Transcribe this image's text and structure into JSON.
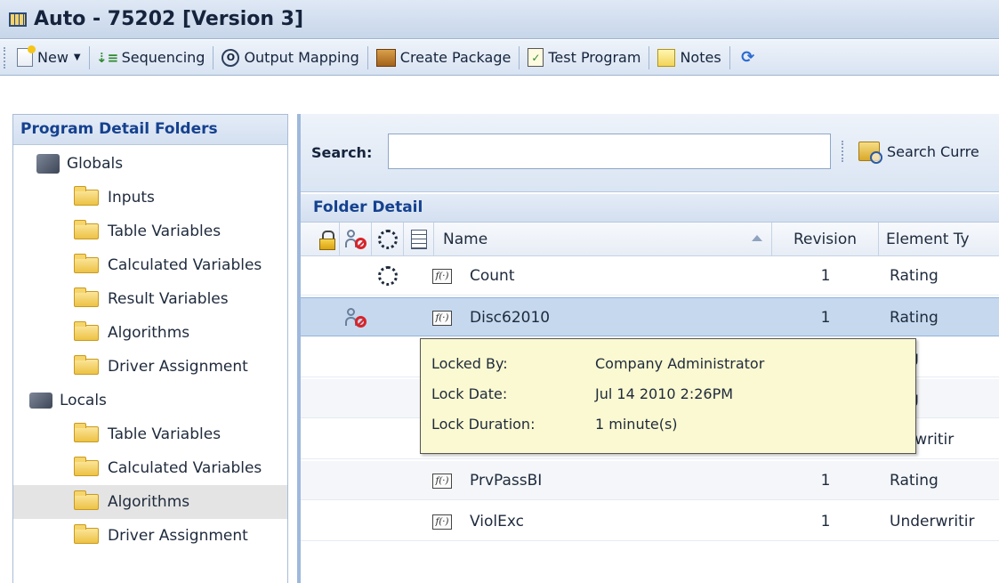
{
  "window": {
    "title": "Auto - 75202 [Version 3]"
  },
  "toolbar": {
    "items": [
      {
        "label": "New",
        "icon": "new-document-icon",
        "has_dropdown": true
      },
      {
        "label": "Sequencing",
        "icon": "sequencing-icon"
      },
      {
        "label": "Output Mapping",
        "icon": "output-mapping-icon"
      },
      {
        "label": "Create Package",
        "icon": "package-icon"
      },
      {
        "label": "Test Program",
        "icon": "test-program-icon"
      },
      {
        "label": "Notes",
        "icon": "notes-icon"
      }
    ]
  },
  "sidebar": {
    "header": "Program Detail Folders",
    "items": [
      {
        "label": "Globals",
        "kind": "group"
      },
      {
        "label": "Inputs",
        "kind": "folder"
      },
      {
        "label": "Table Variables",
        "kind": "folder"
      },
      {
        "label": "Calculated Variables",
        "kind": "folder"
      },
      {
        "label": "Result Variables",
        "kind": "folder"
      },
      {
        "label": "Algorithms",
        "kind": "folder"
      },
      {
        "label": "Driver Assignment",
        "kind": "folder"
      },
      {
        "label": "Locals",
        "kind": "group"
      },
      {
        "label": "Table Variables",
        "kind": "folder"
      },
      {
        "label": "Calculated Variables",
        "kind": "folder"
      },
      {
        "label": "Algorithms",
        "kind": "folder",
        "selected": true
      },
      {
        "label": "Driver Assignment",
        "kind": "folder"
      }
    ]
  },
  "search": {
    "label": "Search:",
    "value": "",
    "button_label": "Search Curre"
  },
  "folder_detail": {
    "header": "Folder Detail",
    "columns": {
      "name": "Name",
      "revision": "Revision",
      "element_type": "Element Ty"
    },
    "rows": [
      {
        "name": "Count",
        "revision": "1",
        "element_type": "Rating",
        "status_icon": "cycle-icon"
      },
      {
        "name": "Disc62010",
        "revision": "1",
        "element_type": "Rating",
        "status_icon": "locked-user-icon",
        "selected": true
      },
      {
        "name": "",
        "revision": "",
        "element_type": "ting"
      },
      {
        "name": "",
        "revision": "",
        "element_type": "ting"
      },
      {
        "name": "",
        "revision": "",
        "element_type": "derwritir"
      },
      {
        "name": "PrvPassBI",
        "revision": "1",
        "element_type": "Rating"
      },
      {
        "name": "ViolExc",
        "revision": "1",
        "element_type": "Underwritir"
      }
    ]
  },
  "tooltip": {
    "locked_by_label": "Locked By:",
    "locked_by_value": "Company Administrator",
    "lock_date_label": "Lock Date:",
    "lock_date_value": "Jul 14 2010 2:26PM",
    "lock_duration_label": "Lock Duration:",
    "lock_duration_value": "1 minute(s)"
  },
  "colors": {
    "header_text": "#15418f",
    "selection": "#c5d8ee",
    "tooltip_bg": "#fbf9d1",
    "lock_red": "#d7242a"
  }
}
